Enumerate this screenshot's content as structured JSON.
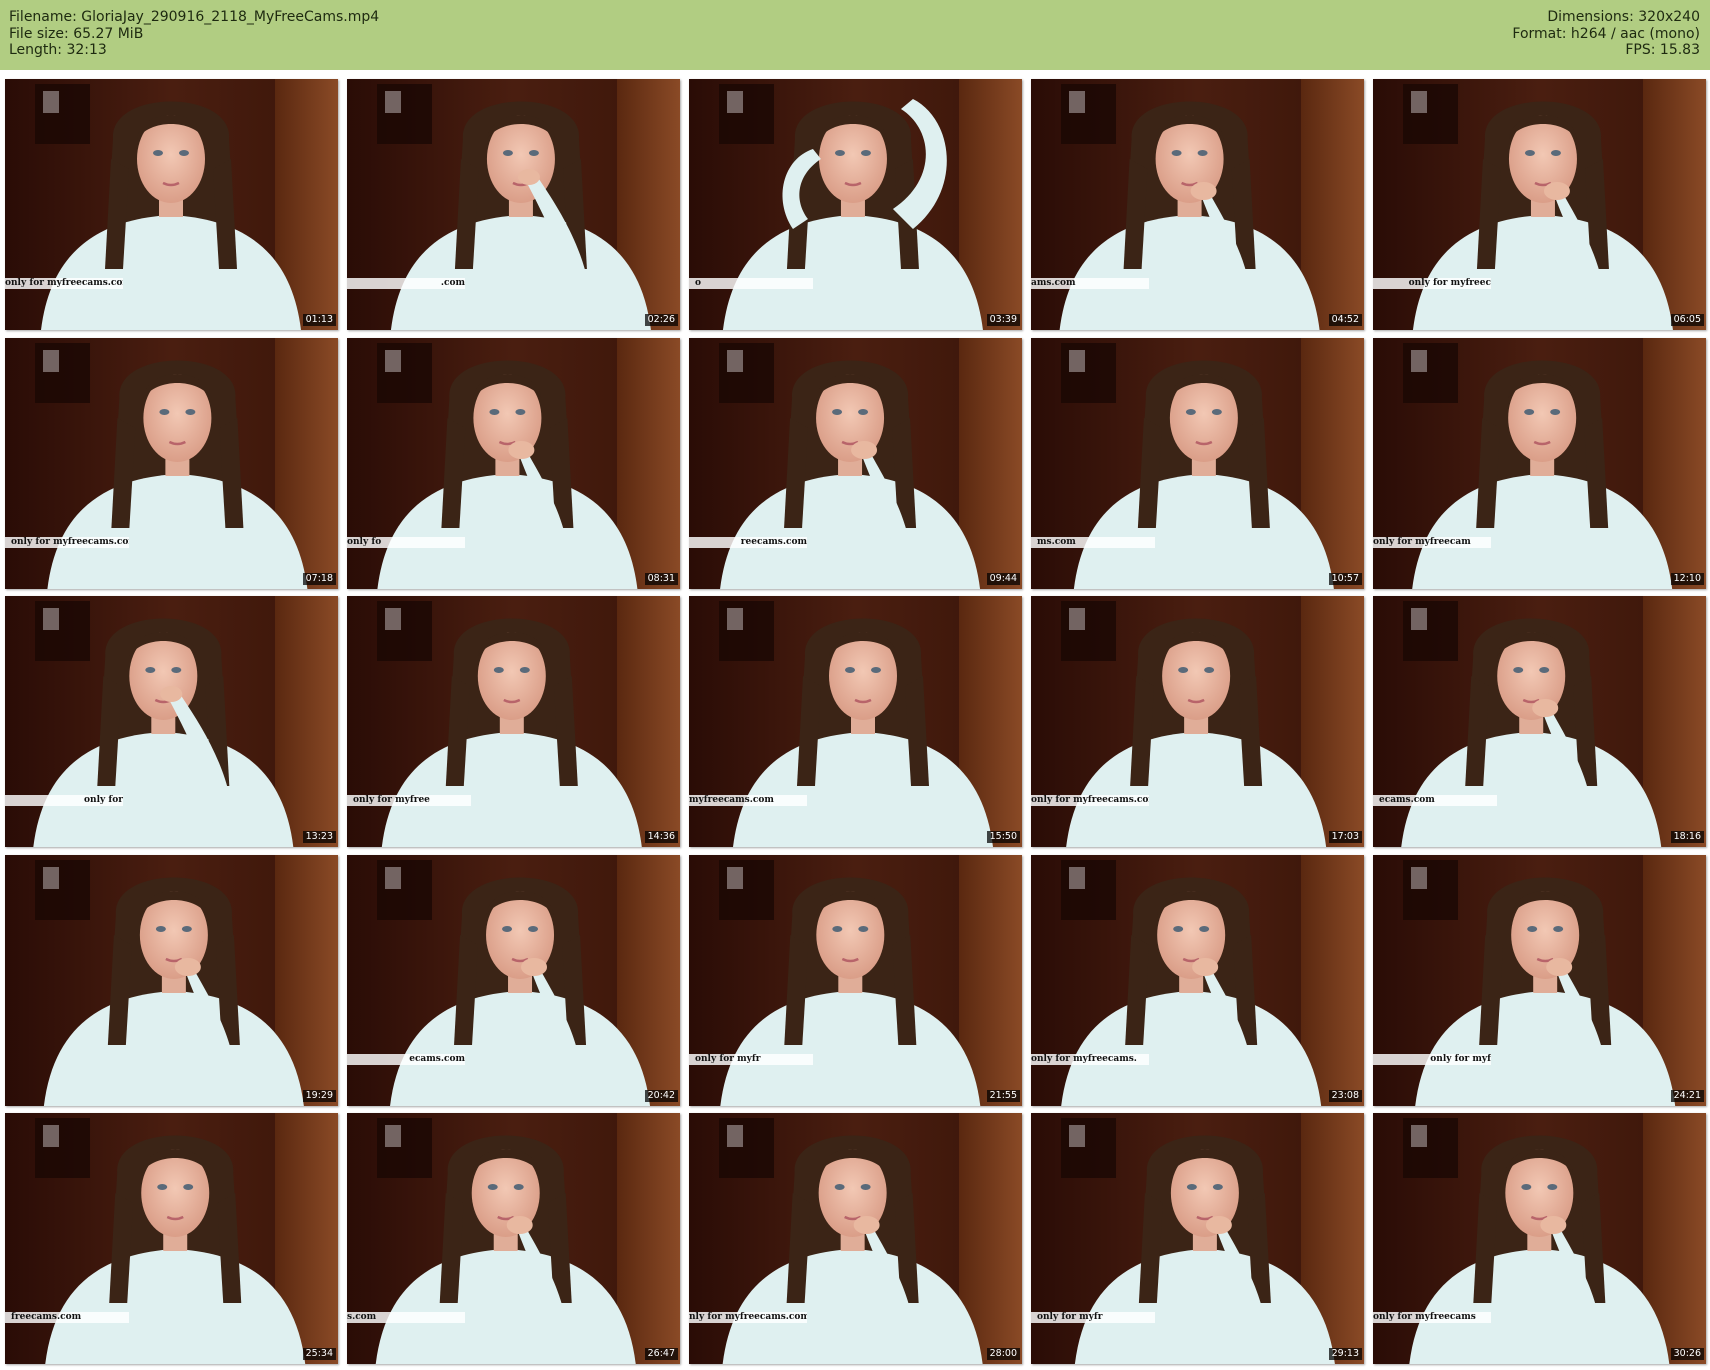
{
  "header": {
    "filename_line": "Filename: GloriaJay_290916_2118_MyFreeCams.mp4",
    "filesize_line": "File size: 65.27 MiB",
    "length_line": "Length: 32:13",
    "dimensions_line": "Dimensions: 320x240",
    "format_line": "Format: h264 / aac (mono)",
    "fps_line": "FPS: 15.83"
  },
  "colors": {
    "header_bg": "#b1cd82",
    "background": "#ffffff",
    "wall": "#4a1e10",
    "door": "#8a4a26",
    "shirt": "#dff0f0",
    "hair": "#3b2416"
  },
  "thumbnails": [
    {
      "time": "01:13",
      "watermark": "only for myfreecams.com",
      "pose": "center"
    },
    {
      "time": "02:26",
      "watermark": ".com",
      "pose": "hand-mouth"
    },
    {
      "time": "03:39",
      "watermark": "o",
      "pose": "arm-up"
    },
    {
      "time": "04:52",
      "watermark": "ams.com",
      "pose": "hand-chin"
    },
    {
      "time": "06:05",
      "watermark": "only for myfreec",
      "pose": "hand-chin"
    },
    {
      "time": "07:18",
      "watermark": "only for myfreecams.com",
      "pose": "center"
    },
    {
      "time": "08:31",
      "watermark": "only fo",
      "pose": "hand-chin"
    },
    {
      "time": "09:44",
      "watermark": "reecams.com",
      "pose": "hand-chin"
    },
    {
      "time": "10:57",
      "watermark": "ms.com",
      "pose": "center"
    },
    {
      "time": "12:10",
      "watermark": "only for myfreecam",
      "pose": "center"
    },
    {
      "time": "13:23",
      "watermark": "only for",
      "pose": "hand-mouth"
    },
    {
      "time": "14:36",
      "watermark": "only for myfree",
      "pose": "center"
    },
    {
      "time": "15:50",
      "watermark": "myfreecams.com",
      "pose": "center"
    },
    {
      "time": "17:03",
      "watermark": "only for myfreecams.con",
      "pose": "center"
    },
    {
      "time": "18:16",
      "watermark": "ecams.com",
      "pose": "hand-chin"
    },
    {
      "time": "19:29",
      "watermark": "",
      "pose": "hand-chin"
    },
    {
      "time": "20:42",
      "watermark": "ecams.com",
      "pose": "hand-chin"
    },
    {
      "time": "21:55",
      "watermark": "only for myfr",
      "pose": "center"
    },
    {
      "time": "23:08",
      "watermark": "only for myfreecams.",
      "pose": "hand-chin"
    },
    {
      "time": "24:21",
      "watermark": "only for myf",
      "pose": "hand-chin"
    },
    {
      "time": "25:34",
      "watermark": "freecams.com",
      "pose": "center"
    },
    {
      "time": "26:47",
      "watermark": "s.com",
      "pose": "hand-chin"
    },
    {
      "time": "28:00",
      "watermark": "nly for myfreecams.com",
      "pose": "hand-chin"
    },
    {
      "time": "29:13",
      "watermark": "only for myfr",
      "pose": "hand-chin"
    },
    {
      "time": "30:26",
      "watermark": "only for myfreecams",
      "pose": "hand-chin"
    }
  ]
}
